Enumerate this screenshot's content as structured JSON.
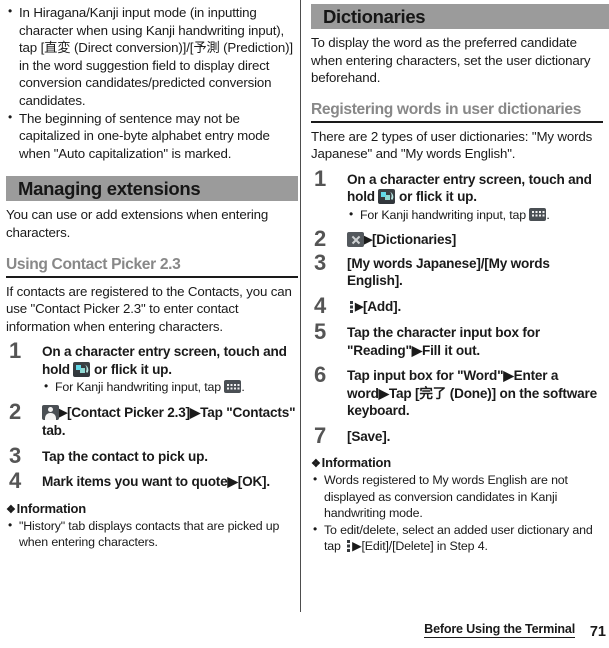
{
  "footer": {
    "section_title": "Before Using the Terminal",
    "page_number": "71"
  },
  "left_column": {
    "top_bullets": [
      "In Hiragana/Kanji input mode (in inputting character when using Kanji handwriting input), tap [直変 (Direct conversion)]/[予測 (Prediction)] in the word suggestion field to display direct conversion candidates/predicted conversion candidates.",
      "The beginning of sentence may not be capitalized in one-byte alphabet entry mode when \"Auto capitalization\" is marked."
    ],
    "section_heading": "Managing extensions",
    "section_intro": "You can use or add extensions when entering characters.",
    "sub_heading": "Using Contact Picker 2.3",
    "sub_intro": "If contacts are registered to the Contacts, you can use \"Contact Picker 2.3\" to enter contact information when entering characters.",
    "steps": [
      {
        "number": "1",
        "text_before_icon": "On a character entry screen, touch and hold ",
        "icon": "handwriting-input-icon",
        "text_after_icon": " or flick it up.",
        "note_before_icon": "For Kanji handwriting input, tap ",
        "note_icon": "keyboard-icon",
        "note_after_icon": "."
      },
      {
        "number": "2",
        "icon": "contact-picker-icon",
        "arrow": "▶",
        "text": "[Contact Picker 2.3]▶Tap \"Contacts\" tab."
      },
      {
        "number": "3",
        "text": "Tap the contact to pick up."
      },
      {
        "number": "4",
        "text": "Mark items you want to quote▶[OK]."
      }
    ],
    "information_label": "Information",
    "information_bullets": [
      "\"History\" tab displays contacts that are picked up when entering characters."
    ]
  },
  "right_column": {
    "section_heading": "Dictionaries",
    "section_intro": "To display the word as the preferred candidate when entering characters, set the user dictionary beforehand.",
    "sub_heading": "Registering words in user dictionaries",
    "sub_intro": "There are 2 types of user dictionaries: \"My words Japanese\" and \"My words English\".",
    "steps": [
      {
        "number": "1",
        "text_before_icon": "On a character entry screen, touch and hold ",
        "icon": "handwriting-input-icon",
        "text_after_icon": " or flick it up.",
        "note_before_icon": "For Kanji handwriting input, tap ",
        "note_icon": "keyboard-icon",
        "note_after_icon": "."
      },
      {
        "number": "2",
        "icon": "close-icon",
        "arrow": "▶",
        "text": "[Dictionaries]"
      },
      {
        "number": "3",
        "text": "[My words Japanese]/[My words English]."
      },
      {
        "number": "4",
        "icon": "overflow-menu-icon",
        "arrow": "▶",
        "text": "[Add]."
      },
      {
        "number": "5",
        "text": "Tap the character input box for \"Reading\"▶Fill it out."
      },
      {
        "number": "6",
        "text": "Tap input box for \"Word\"▶Enter a word▶Tap [完了 (Done)] on the software keyboard."
      },
      {
        "number": "7",
        "text": "[Save]."
      }
    ],
    "information_label": "Information",
    "information_bullets": [
      "Words registered to My words English are not displayed as conversion candidates in Kanji handwriting mode."
    ],
    "information_bullet_edit_before": "To edit/delete, select an added user dictionary and tap ",
    "information_bullet_edit_icon": "overflow-menu-icon",
    "information_bullet_edit_after": "▶[Edit]/[Delete] in Step 4."
  },
  "colors": {
    "section_bar_bg": "#9b9b9b",
    "sub_heading_text": "#888888",
    "step_number": "#555555",
    "body_text": "#1a1a1a"
  }
}
